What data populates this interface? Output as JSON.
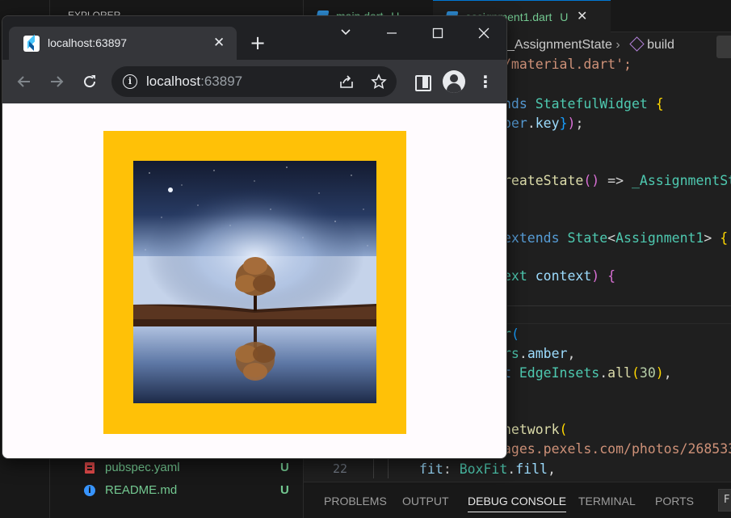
{
  "vscode": {
    "explorer_title": "EXPLORER",
    "tabs": [
      {
        "label": "main.dart",
        "status": "U"
      },
      {
        "label": "assignment1.dart",
        "status": "U"
      }
    ],
    "breadcrumb": {
      "class_item": "_AssignmentState",
      "method_item": "build"
    },
    "code_lines": [
      "/material.dart';",
      "nds StatefulWidget {",
      "per.key});",
      "reateState() => _AssignmentSta",
      "extends State<Assignment1> {",
      "ext context) {",
      "r(",
      "rs.amber,",
      "t EdgeInsets.all(30),",
      "network(",
      "ages.pexels.com/photos/268533",
      "fit: BoxFit.fill,"
    ],
    "line_number": "22",
    "files": [
      {
        "name": "pubspec.yaml",
        "status": "U"
      },
      {
        "name": "README.md",
        "status": "U"
      }
    ],
    "panel_tabs": [
      "PROBLEMS",
      "OUTPUT",
      "DEBUG CONSOLE",
      "TERMINAL",
      "PORTS"
    ],
    "active_panel_tab": "DEBUG CONSOLE",
    "panel_box_label": "F"
  },
  "browser": {
    "tab_title": "localhost:63897",
    "url_host": "localhost",
    "url_port": ":63897",
    "page": {
      "container_color": "#ffc107",
      "container_padding": "30",
      "image_description": "tree reflected in lake under a starry night sky"
    }
  }
}
